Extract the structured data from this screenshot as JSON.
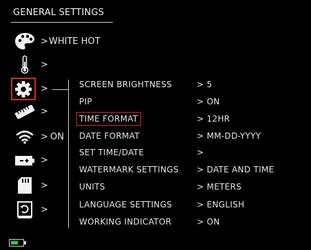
{
  "header": {
    "title": "GENERAL SETTINGS"
  },
  "left_menu": {
    "items": [
      {
        "icon": "palette-icon",
        "value": "WHITE HOT"
      },
      {
        "icon": "thermometer-icon",
        "value": ""
      },
      {
        "icon": "gear-icon",
        "value": "",
        "selected": true
      },
      {
        "icon": "ruler-icon",
        "value": ""
      },
      {
        "icon": "wifi-icon",
        "value": "ON"
      },
      {
        "icon": "battery-plus-icon",
        "value": ""
      },
      {
        "icon": "sd-card-icon",
        "value": ""
      },
      {
        "icon": "restore-icon",
        "value": ""
      }
    ]
  },
  "settings": {
    "rows": [
      {
        "label": "SCREEN BRIGHTNESS",
        "value": "5"
      },
      {
        "label": "PIP",
        "value": "ON"
      },
      {
        "label": "TIME FORMAT",
        "value": "12HR",
        "selected": true
      },
      {
        "label": "DATE FORMAT",
        "value": "MM-DD-YYYY"
      },
      {
        "label": "SET TIME/DATE",
        "value": ""
      },
      {
        "label": "WATERMARK SETTINGS",
        "value": "DATE AND TIME"
      },
      {
        "label": "UNITS",
        "value": "METERS"
      },
      {
        "label": "LANGUAGE SETTINGS",
        "value": "ENGLISH"
      },
      {
        "label": "WORKING INDICATOR",
        "value": "ON"
      }
    ]
  },
  "status": {
    "battery_level": 0.6,
    "battery_color": "#22d03a"
  },
  "colors": {
    "selection": "#d12b2b",
    "text": "#e8e8e8",
    "background": "#000000"
  }
}
